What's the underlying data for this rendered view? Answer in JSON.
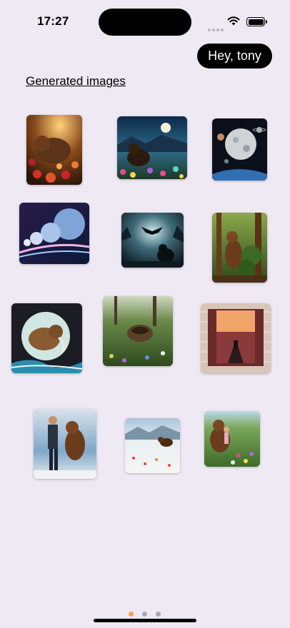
{
  "status_bar": {
    "time": "17:27"
  },
  "header": {
    "greeting": "Hey, tony"
  },
  "section": {
    "title": "Generated images"
  },
  "images": [
    {
      "name": "bear-in-flowers",
      "icon": "image-thumbnail"
    },
    {
      "name": "bear-moonlit-meadow",
      "icon": "image-thumbnail"
    },
    {
      "name": "moon-planets",
      "icon": "image-thumbnail"
    },
    {
      "name": "planets-galaxy",
      "icon": "image-thumbnail"
    },
    {
      "name": "bat-bear-night",
      "icon": "image-thumbnail"
    },
    {
      "name": "bear-forest",
      "icon": "image-thumbnail"
    },
    {
      "name": "mammoth-moon",
      "icon": "image-thumbnail"
    },
    {
      "name": "nest-meadow",
      "icon": "image-thumbnail"
    },
    {
      "name": "brick-wall-portal",
      "icon": "image-thumbnail"
    },
    {
      "name": "man-and-bear",
      "icon": "image-thumbnail"
    },
    {
      "name": "bear-snowfield",
      "icon": "image-thumbnail"
    },
    {
      "name": "bear-and-girl-meadow",
      "icon": "image-thumbnail"
    }
  ],
  "pager": {
    "active_index": 0,
    "count": 3
  },
  "colors": {
    "background": "#efe9f4",
    "accent": "#f5a04d",
    "greeting_bg": "#000000"
  }
}
